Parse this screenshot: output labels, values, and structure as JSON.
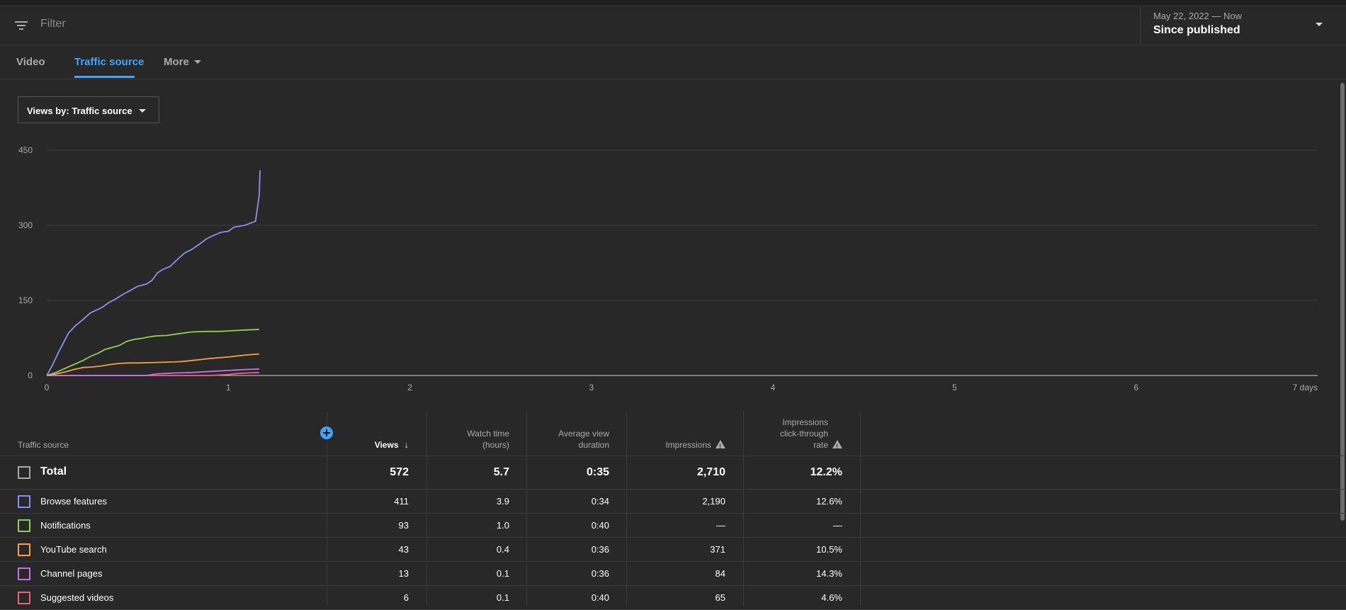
{
  "filter": {
    "placeholder": "Filter"
  },
  "date": {
    "range": "May 22, 2022 — Now",
    "label": "Since published"
  },
  "tabs": [
    {
      "label": "Video",
      "active": false
    },
    {
      "label": "Traffic source",
      "active": true
    },
    {
      "label": "More",
      "active": false
    }
  ],
  "metric_selector": {
    "label": "Views by: Traffic source"
  },
  "colors": {
    "accent": "#3ea6ff",
    "background": "#282828"
  },
  "chart_data": {
    "type": "line",
    "title": "",
    "xlabel": "",
    "ylabel": "",
    "xlim": [
      0,
      7
    ],
    "ylim": [
      0,
      450
    ],
    "x_ticks": [
      "0",
      "1",
      "2",
      "3",
      "4",
      "5",
      "6",
      "7 days"
    ],
    "y_ticks": [
      "0",
      "150",
      "300",
      "450"
    ],
    "grid": true,
    "series": [
      {
        "name": "Browse features",
        "color": "#8891f3",
        "x": [
          0,
          0.03,
          0.07,
          0.12,
          0.16,
          0.2,
          0.24,
          0.3,
          0.34,
          0.38,
          0.42,
          0.46,
          0.5,
          0.55,
          0.58,
          0.61,
          0.64,
          0.68,
          0.72,
          0.76,
          0.8,
          0.84,
          0.88,
          0.92,
          0.96,
          1.0,
          1.03,
          1.06,
          1.09,
          1.12,
          1.15,
          1.17,
          1.175
        ],
        "y": [
          0,
          20,
          50,
          85,
          100,
          112,
          125,
          135,
          145,
          153,
          162,
          170,
          178,
          183,
          190,
          205,
          212,
          218,
          232,
          245,
          252,
          262,
          273,
          280,
          286,
          288,
          296,
          298,
          300,
          304,
          308,
          360,
          410
        ]
      },
      {
        "name": "Notifications",
        "color": "#8fd14f",
        "x": [
          0,
          0.05,
          0.1,
          0.15,
          0.2,
          0.24,
          0.28,
          0.32,
          0.36,
          0.4,
          0.44,
          0.48,
          0.52,
          0.56,
          0.6,
          0.66,
          0.72,
          0.8,
          0.88,
          0.95,
          1.0,
          1.05,
          1.1,
          1.17
        ],
        "y": [
          0,
          6,
          14,
          22,
          30,
          38,
          44,
          52,
          56,
          60,
          68,
          72,
          74,
          77,
          79,
          80,
          83,
          87,
          88,
          88,
          89,
          90,
          91,
          92
        ]
      },
      {
        "name": "YouTube search",
        "color": "#f5a33b",
        "x": [
          0,
          0.05,
          0.1,
          0.15,
          0.2,
          0.25,
          0.3,
          0.35,
          0.4,
          0.45,
          0.5,
          0.6,
          0.7,
          0.75,
          0.8,
          0.9,
          1.0,
          1.1,
          1.17
        ],
        "y": [
          0,
          3,
          7,
          12,
          16,
          17,
          19,
          22,
          24,
          25,
          25,
          26,
          27,
          28,
          30,
          34,
          37,
          41,
          43
        ]
      },
      {
        "name": "Channel pages",
        "color": "#c372e8",
        "x": [
          0,
          0.55,
          0.6,
          0.65,
          0.7,
          0.8,
          0.9,
          1.0,
          1.05,
          1.1,
          1.17
        ],
        "y": [
          0,
          0,
          3,
          4,
          5,
          6,
          8,
          10,
          11,
          12,
          13
        ]
      },
      {
        "name": "Suggested videos",
        "color": "#ee6183",
        "x": [
          0,
          0.9,
          0.95,
          1.0,
          1.05,
          1.1,
          1.17
        ],
        "y": [
          0,
          0,
          1,
          2,
          4,
          5,
          6
        ]
      }
    ]
  },
  "table": {
    "headers": {
      "source": "Traffic source",
      "views": "Views",
      "watch_time": [
        "Watch time",
        "(hours)"
      ],
      "avg_duration": [
        "Average view",
        "duration"
      ],
      "impressions": "Impressions",
      "ctr": [
        "Impressions",
        "click-through",
        "rate"
      ]
    },
    "total": {
      "name": "Total",
      "views": "572",
      "watch_time": "5.7",
      "avg_duration": "0:35",
      "impressions": "2,710",
      "ctr": "12.2%"
    },
    "rows": [
      {
        "name": "Browse features",
        "color": "#8891f3",
        "views": "411",
        "watch_time": "3.9",
        "avg_duration": "0:34",
        "impressions": "2,190",
        "ctr": "12.6%"
      },
      {
        "name": "Notifications",
        "color": "#8fd14f",
        "views": "93",
        "watch_time": "1.0",
        "avg_duration": "0:40",
        "impressions": "—",
        "ctr": "—"
      },
      {
        "name": "YouTube search",
        "color": "#f5a33b",
        "views": "43",
        "watch_time": "0.4",
        "avg_duration": "0:36",
        "impressions": "371",
        "ctr": "10.5%"
      },
      {
        "name": "Channel pages",
        "color": "#c372e8",
        "views": "13",
        "watch_time": "0.1",
        "avg_duration": "0:36",
        "impressions": "84",
        "ctr": "14.3%"
      },
      {
        "name": "Suggested videos",
        "color": "#ee6183",
        "views": "6",
        "watch_time": "0.1",
        "avg_duration": "0:40",
        "impressions": "65",
        "ctr": "4.6%"
      }
    ]
  }
}
